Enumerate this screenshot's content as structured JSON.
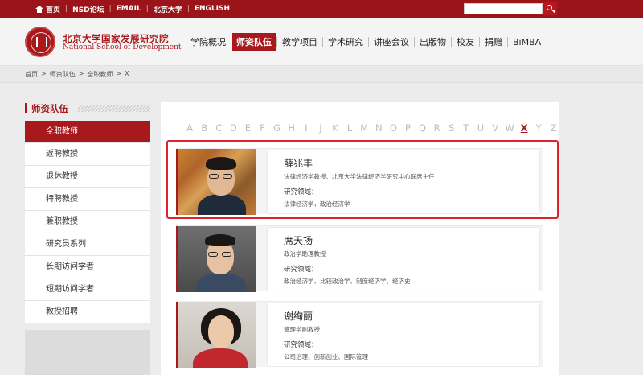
{
  "topbar": {
    "links": [
      "首页",
      "NSD论坛",
      "EMAIL",
      "北京大学",
      "ENGLISH"
    ],
    "search_placeholder": ""
  },
  "header": {
    "logo_cn": "北京大学国家发展研究院",
    "logo_en": "National School of Development",
    "nav": [
      "学院概况",
      "师资队伍",
      "教学项目",
      "学术研究",
      "讲座会议",
      "出版物",
      "校友",
      "捐赠",
      "BiMBA"
    ],
    "active_nav": "师资队伍"
  },
  "breadcrumb": [
    "首页",
    ">",
    "师资队伍",
    ">",
    "全职教师",
    ">",
    "X"
  ],
  "sidebar": {
    "title": "师资队伍",
    "items": [
      "全职教师",
      "返聘教授",
      "退休教授",
      "特聘教授",
      "兼职教授",
      "研究员系列",
      "长期访问学者",
      "短期访问学者",
      "教授招聘"
    ],
    "active": "全职教师"
  },
  "alphabet": {
    "letters": [
      "A",
      "B",
      "C",
      "D",
      "E",
      "F",
      "G",
      "H",
      "I",
      "J",
      "K",
      "L",
      "M",
      "N",
      "O",
      "P",
      "Q",
      "R",
      "S",
      "T",
      "U",
      "V",
      "W",
      "X",
      "Y",
      "Z"
    ],
    "active": "X"
  },
  "faculty": [
    {
      "name": "薛兆丰",
      "title": "法律经济学教授、北京大学法律经济学研究中心联席主任",
      "field_label": "研究领域：",
      "fields": "法律经济学，政治经济学",
      "highlighted": true
    },
    {
      "name": "席天扬",
      "title": "政治学助理教授",
      "field_label": "研究领域：",
      "fields": "政治经济学、比较政治学、制度经济学、经济史",
      "highlighted": false
    },
    {
      "name": "谢绚丽",
      "title": "管理学副教授",
      "field_label": "研究领域：",
      "fields": "公司治理、创新创业、国际管理",
      "highlighted": false
    }
  ],
  "colors": {
    "brand_red": "#9b1419",
    "active_red": "#a8191e",
    "highlight_border": "#e0222c"
  },
  "icons": {
    "home": "home-icon",
    "search": "search-icon",
    "logo": "pku-seal-logo"
  }
}
